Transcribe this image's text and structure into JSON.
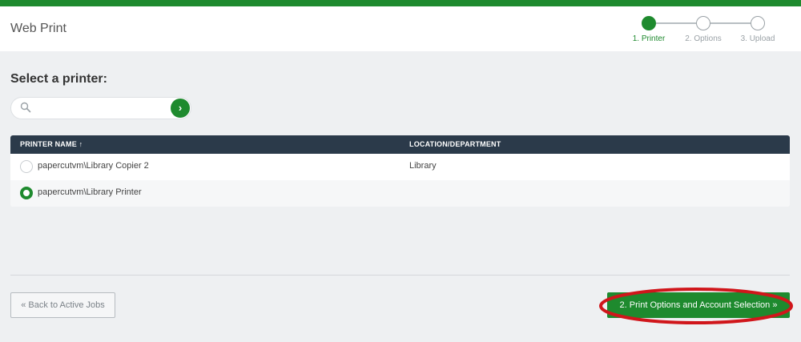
{
  "header": {
    "app_title": "Web Print",
    "steps": [
      {
        "label": "1. Printer",
        "active": true
      },
      {
        "label": "2. Options",
        "active": false
      },
      {
        "label": "3. Upload",
        "active": false
      }
    ]
  },
  "main": {
    "section_title": "Select a printer:",
    "search": {
      "placeholder": "",
      "value": "",
      "go_label": "›"
    },
    "table": {
      "columns": [
        "PRINTER NAME ↑",
        "LOCATION/DEPARTMENT"
      ],
      "rows": [
        {
          "name": "papercutvm\\Library Copier 2",
          "location": "Library",
          "selected": false
        },
        {
          "name": "papercutvm\\Library Printer",
          "location": "",
          "selected": true
        }
      ]
    }
  },
  "footer": {
    "back_label": "« Back to Active Jobs",
    "next_label": "2. Print Options and Account Selection »"
  },
  "colors": {
    "accent": "#1e8a2e",
    "table_header": "#2b3a4a",
    "annotation": "#d0161b"
  }
}
